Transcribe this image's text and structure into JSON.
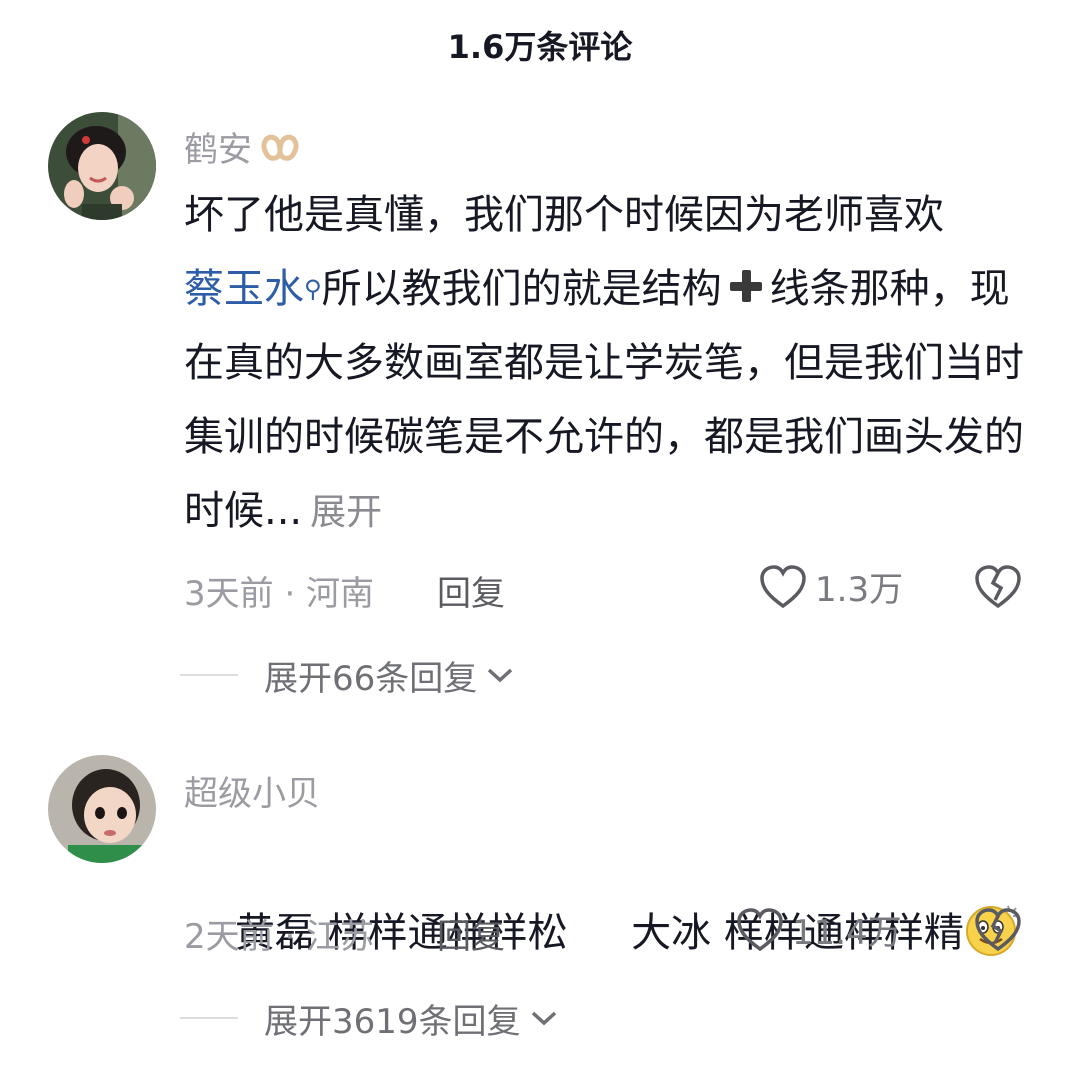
{
  "header": {
    "title": "1.6万条评论"
  },
  "comments": [
    {
      "username": "鹤安",
      "username_badge": "pretzel-emoji",
      "text_part1": "坏了他是真懂，我们那个时候因为老师喜欢",
      "mention": "蔡玉水",
      "text_part2": "所以教我们的就是结构",
      "text_part3": "线条那种，现在真的大多数画室都是让学炭笔，但是我们当时集训的时候碳笔是不允许的，都是我们画头发的时候...",
      "expand_label": "展开",
      "time_location": "3天前 · 河南",
      "reply_label": "回复",
      "like_count": "1.3万",
      "replies_label": "展开66条回复"
    },
    {
      "username": "超级小贝",
      "text": "黄磊 样样通样样松     大冰 样样通样样精",
      "trailing_emoji": "dizzy-smile-emoji",
      "time_location": "2天前 · 江苏",
      "reply_label": "回复",
      "like_count": "11.4万",
      "replies_label": "展开3619条回复"
    }
  ],
  "colors": {
    "mention": "#2e5da8",
    "meta": "#9b9ca3",
    "text": "#161823"
  }
}
